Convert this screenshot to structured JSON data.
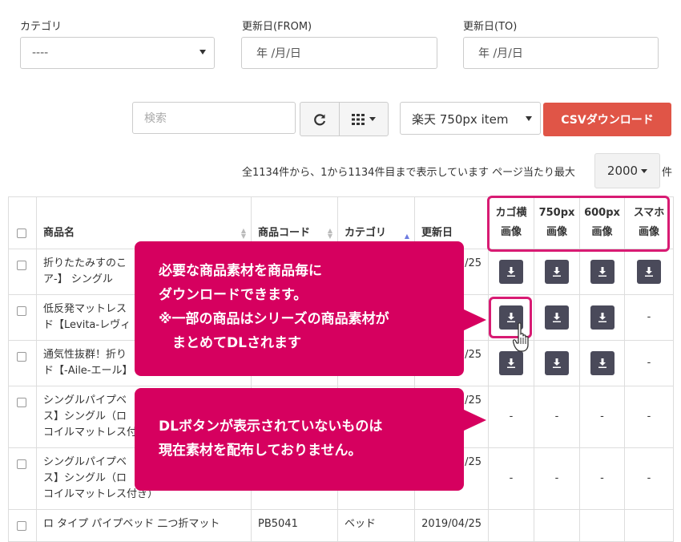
{
  "filters": {
    "category": {
      "label": "カテゴリ",
      "value": "----"
    },
    "date_from": {
      "label": "更新日(FROM)",
      "value": "年 /月/日"
    },
    "date_to": {
      "label": "更新日(TO)",
      "value": "年 /月/日"
    }
  },
  "toolbar": {
    "search_placeholder": "検索",
    "image_type_select": "楽天 750px item",
    "csv_button": "CSVダウンロード"
  },
  "pagination": {
    "info": "全1134件から、1から1134件目まで表示しています ページ当たり最大",
    "page_size": "2000",
    "suffix": "件"
  },
  "table": {
    "headers": {
      "name": "商品名",
      "code": "商品コード",
      "category": "カテゴリ",
      "updated": "更新日",
      "cart_line1": "カゴ横",
      "cart_line2": "画像",
      "w750_line1": "750px",
      "w750_line2": "画像",
      "w600_line1": "600px",
      "w600_line2": "画像",
      "sp_line1": "スマホ",
      "sp_line2": "画像"
    },
    "rows": [
      {
        "name_l1": "折りたたみすのこ",
        "name_l2": "ア-】 シングル",
        "name_l3": "",
        "code": "",
        "category": "",
        "date": "/25",
        "cart": "dl",
        "w750": "dl",
        "w600": "dl",
        "sp": "dl"
      },
      {
        "name_l1": "低反発マットレス",
        "name_l2": "ド【Levita-レヴィ",
        "name_l3": "",
        "code": "",
        "category": "",
        "date": "",
        "cart": "dl",
        "w750": "dl",
        "w600": "dl",
        "sp": "-"
      },
      {
        "name_l1": "通気性抜群！折り",
        "name_l2": "ド【-Aile-エール】",
        "name_l3": "",
        "code": "",
        "category": "",
        "date": "/25",
        "cart": "dl",
        "w750": "dl",
        "w600": "dl",
        "sp": "-"
      },
      {
        "name_l1": "シングルパイプベ",
        "name_l2": "ス】シングル（ロ",
        "name_l3": "コイルマットレス付",
        "code": "",
        "category": "",
        "date": "/25",
        "cart": "-",
        "w750": "-",
        "w600": "-",
        "sp": "-"
      },
      {
        "name_l1": "シングルパイプベ",
        "name_l2": "ス】シングル（ロ",
        "name_l3": "コイルマットレス付き）",
        "code": "",
        "category": "",
        "date": "/25",
        "cart": "-",
        "w750": "-",
        "w600": "-",
        "sp": "-"
      },
      {
        "name_l1": "ロ タイプ パイプベッド 二つ折マット",
        "name_l2": "",
        "name_l3": "",
        "code": "PB5041",
        "category": "ベッド",
        "date": "2019/04/25",
        "cart": "",
        "w750": "",
        "w600": "",
        "sp": ""
      }
    ]
  },
  "callouts": {
    "top": {
      "line1": "必要な商品素材を商品毎に",
      "line2": "ダウンロードできます。",
      "line3": "※一部の商品はシリーズの商品素材が",
      "line4": "　まとめてDLされます"
    },
    "bottom": {
      "line1": "DLボタンが表示されていないものは",
      "line2": "現在素材を配布しておりません。"
    }
  },
  "colors": {
    "csv_button": "#e05547",
    "callout": "#d6005f",
    "dl_button": "#4a4a5a"
  }
}
